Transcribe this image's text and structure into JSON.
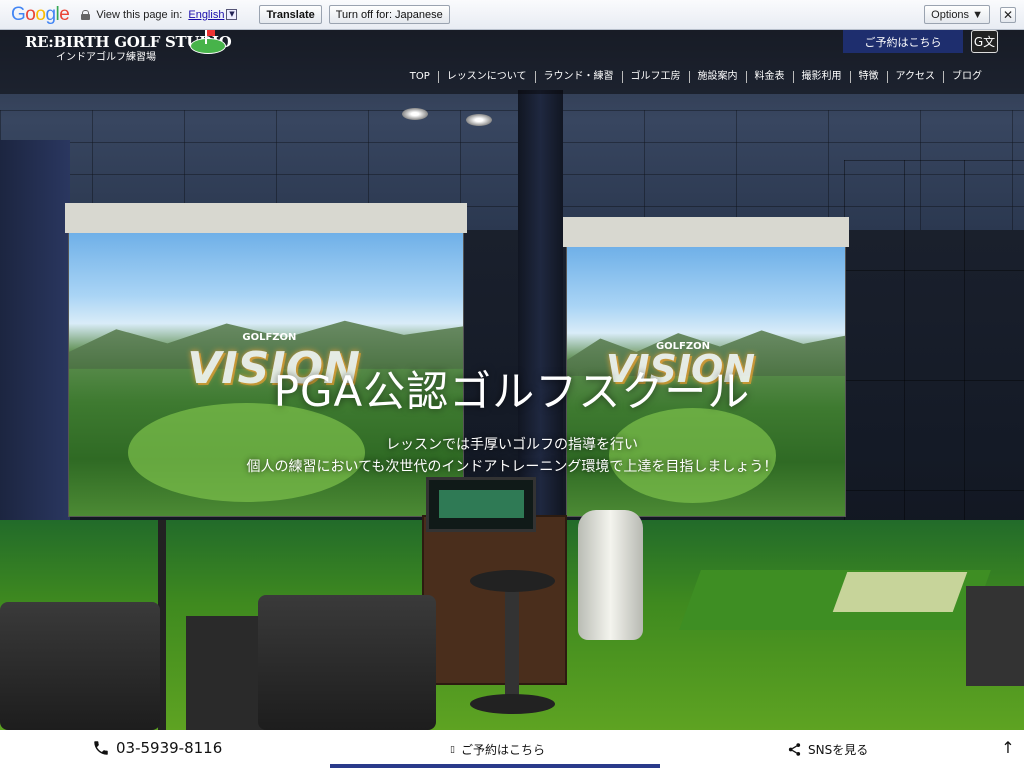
{
  "translate_bar": {
    "logo": "Google",
    "view_text": "View this page in:",
    "language": "English",
    "translate_label": "Translate",
    "turn_off_label": "Turn off for: Japanese",
    "options_label": "Options ▼",
    "close_label": "✕"
  },
  "site": {
    "brand_name": "RE:BIRTH GOLF STUDIO",
    "brand_sub": "インドアゴルフ練習場",
    "reserve_label": "ご予約はこちら",
    "translate_icon": "G文",
    "nav": [
      "TOP",
      "レッスンについて",
      "ラウンド・練習",
      "ゴルフ工房",
      "施設案内",
      "料金表",
      "撮影利用",
      "特徴",
      "アクセス",
      "ブログ"
    ]
  },
  "hero": {
    "title": "PGA公認ゴルフスクール",
    "subtitle_line1": "レッスンでは手厚いゴルフの指導を行い",
    "subtitle_line2": "個人の練習においても次世代のインドアトレーニング環境で上達を目指しましょう！",
    "screen_logo": "VISION",
    "screen_brand": "GOLFZON"
  },
  "bottom_bar": {
    "phone": "03-5939-8116",
    "reserve": "ご予約はこちら",
    "sns": "SNSを見る",
    "top_arrow": "↑"
  },
  "colors": {
    "reserve_button": "#1e2e6e",
    "turf": "#3f8a1f"
  },
  "icons": {
    "phone": "phone-icon",
    "share": "share-icon",
    "lock": "lock-icon"
  }
}
